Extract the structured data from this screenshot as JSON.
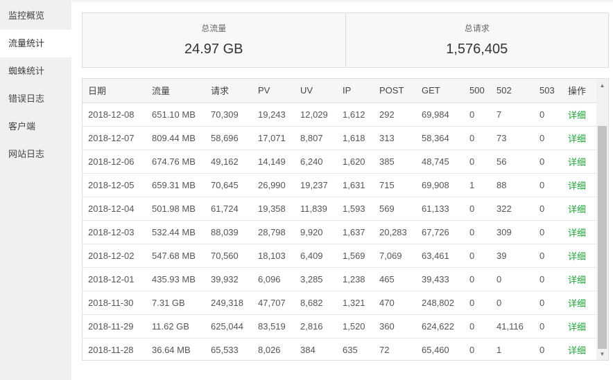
{
  "sidebar": {
    "items": [
      {
        "label": "监控概览"
      },
      {
        "label": "流量统计"
      },
      {
        "label": "蜘蛛统计"
      },
      {
        "label": "错误日志"
      },
      {
        "label": "客户端"
      },
      {
        "label": "网站日志"
      }
    ]
  },
  "summary": {
    "total_traffic": {
      "label": "总流量",
      "value": "24.97 GB"
    },
    "total_requests": {
      "label": "总请求",
      "value": "1,576,405"
    }
  },
  "table": {
    "columns": [
      "日期",
      "流量",
      "请求",
      "PV",
      "UV",
      "IP",
      "POST",
      "GET",
      "500",
      "502",
      "503",
      "操作"
    ],
    "rows": [
      [
        "2018-12-08",
        "651.10 MB",
        "70,309",
        "19,243",
        "12,029",
        "1,612",
        "292",
        "69,984",
        "0",
        "7",
        "0",
        "详细"
      ],
      [
        "2018-12-07",
        "809.44 MB",
        "58,696",
        "17,071",
        "8,807",
        "1,618",
        "313",
        "58,364",
        "0",
        "73",
        "0",
        "详细"
      ],
      [
        "2018-12-06",
        "674.76 MB",
        "49,162",
        "14,149",
        "6,240",
        "1,620",
        "385",
        "48,745",
        "0",
        "56",
        "0",
        "详细"
      ],
      [
        "2018-12-05",
        "659.31 MB",
        "70,645",
        "26,990",
        "19,237",
        "1,631",
        "715",
        "69,908",
        "1",
        "88",
        "0",
        "详细"
      ],
      [
        "2018-12-04",
        "501.98 MB",
        "61,724",
        "19,358",
        "11,839",
        "1,593",
        "569",
        "61,133",
        "0",
        "322",
        "0",
        "详细"
      ],
      [
        "2018-12-03",
        "532.44 MB",
        "88,039",
        "28,798",
        "9,920",
        "1,637",
        "20,283",
        "67,726",
        "0",
        "309",
        "0",
        "详细"
      ],
      [
        "2018-12-02",
        "547.68 MB",
        "70,560",
        "18,103",
        "6,409",
        "1,569",
        "7,069",
        "63,461",
        "0",
        "39",
        "0",
        "详细"
      ],
      [
        "2018-12-01",
        "435.93 MB",
        "39,932",
        "6,096",
        "3,285",
        "1,238",
        "465",
        "39,433",
        "0",
        "0",
        "0",
        "详细"
      ],
      [
        "2018-11-30",
        "7.31 GB",
        "249,318",
        "47,707",
        "8,682",
        "1,321",
        "470",
        "248,802",
        "0",
        "0",
        "0",
        "详细"
      ],
      [
        "2018-11-29",
        "11.62 GB",
        "625,044",
        "83,519",
        "2,816",
        "1,520",
        "360",
        "624,622",
        "0",
        "41,116",
        "0",
        "详细"
      ],
      [
        "2018-11-28",
        "36.64 MB",
        "65,533",
        "8,026",
        "384",
        "635",
        "72",
        "65,460",
        "0",
        "1",
        "0",
        "详细"
      ]
    ]
  },
  "scrollbar": {
    "up_arrow": "▲",
    "down_arrow": "▼"
  }
}
